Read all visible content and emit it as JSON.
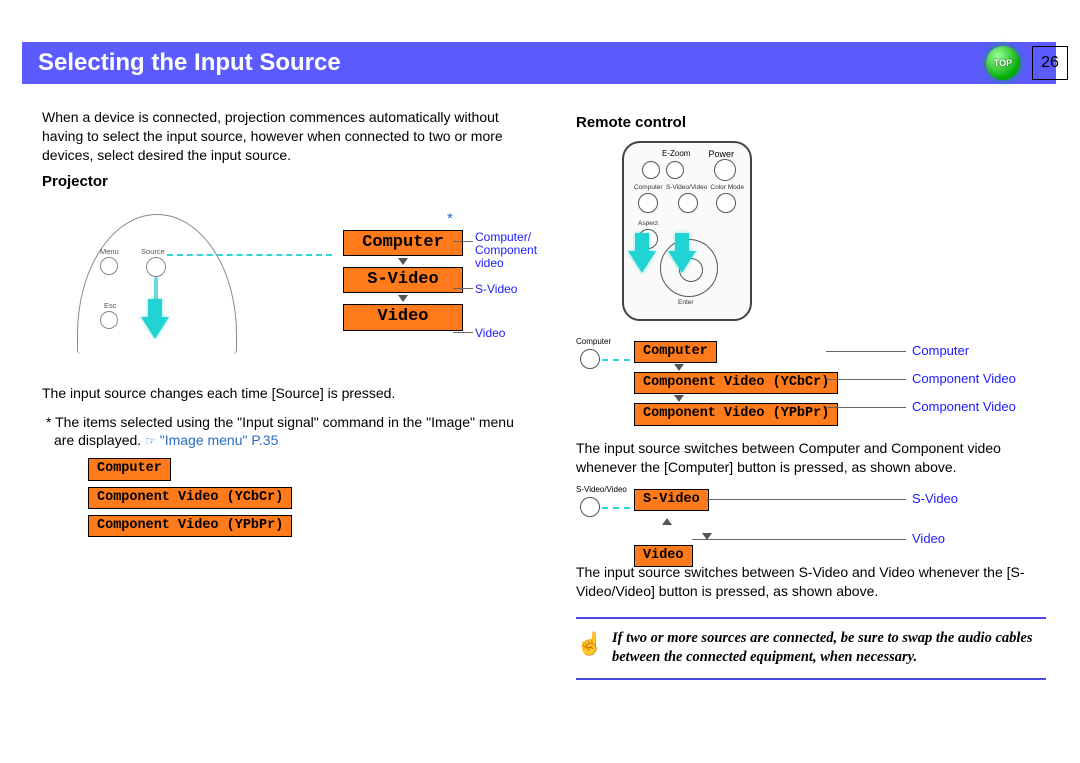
{
  "header": {
    "title": "Selecting the Input Source",
    "top_badge": "TOP",
    "page_number": "26"
  },
  "left": {
    "intro": "When a device is connected, projection commences automatically without having to select the input source, however when connected to two or more devices, select desired the input source.",
    "projector_heading": "Projector",
    "diagram": {
      "menu": "Menu",
      "source": "Source",
      "esc": "Esc",
      "star": "*",
      "stack": {
        "computer": "Computer",
        "svideo": "S-Video",
        "video": "Video"
      },
      "labels": {
        "computer": "Computer/\nComponent video",
        "svideo": "S-Video",
        "video": "Video"
      }
    },
    "after_diagram": "The input source changes each time [Source] is pressed.",
    "footnote_prefix": "* The items selected using the \"Input signal\" command in the \"Image\" menu are displayed. ",
    "footnote_link": "\"Image menu\" P.35",
    "tags": {
      "computer": "Computer",
      "ycbcr": "Component Video (YCbCr)",
      "ypbpr": "Component Video (YPbPr)"
    }
  },
  "right": {
    "remote_heading": "Remote control",
    "remote_labels": {
      "ezoom": "E-Zoom",
      "power": "Power",
      "computer": "Computer",
      "svideo_video": "S-Video/Video",
      "colormode": "Color Mode",
      "aspect": "Aspect",
      "enter": "Enter"
    },
    "block1": {
      "btn_label": "Computer",
      "rows": {
        "computer": "Computer",
        "ycbcr": "Component Video (YCbCr)",
        "ypbpr": "Component Video (YPbPr)"
      },
      "right": {
        "computer": "Computer",
        "cv1": "Component Video",
        "cv2": "Component Video"
      },
      "desc": "The input source switches between Computer and Component video whenever the [Computer] button is pressed, as shown above."
    },
    "block2": {
      "btn_label": "S-Video/Video",
      "rows": {
        "svideo": "S-Video",
        "video": "Video"
      },
      "right": {
        "svideo": "S-Video",
        "video": "Video"
      },
      "desc": "The input source switches between S-Video and Video whenever the [S-Video/Video] button is pressed, as shown above."
    },
    "note": "If two or more sources are connected, be sure to swap the audio cables between the connected equipment, when necessary."
  }
}
